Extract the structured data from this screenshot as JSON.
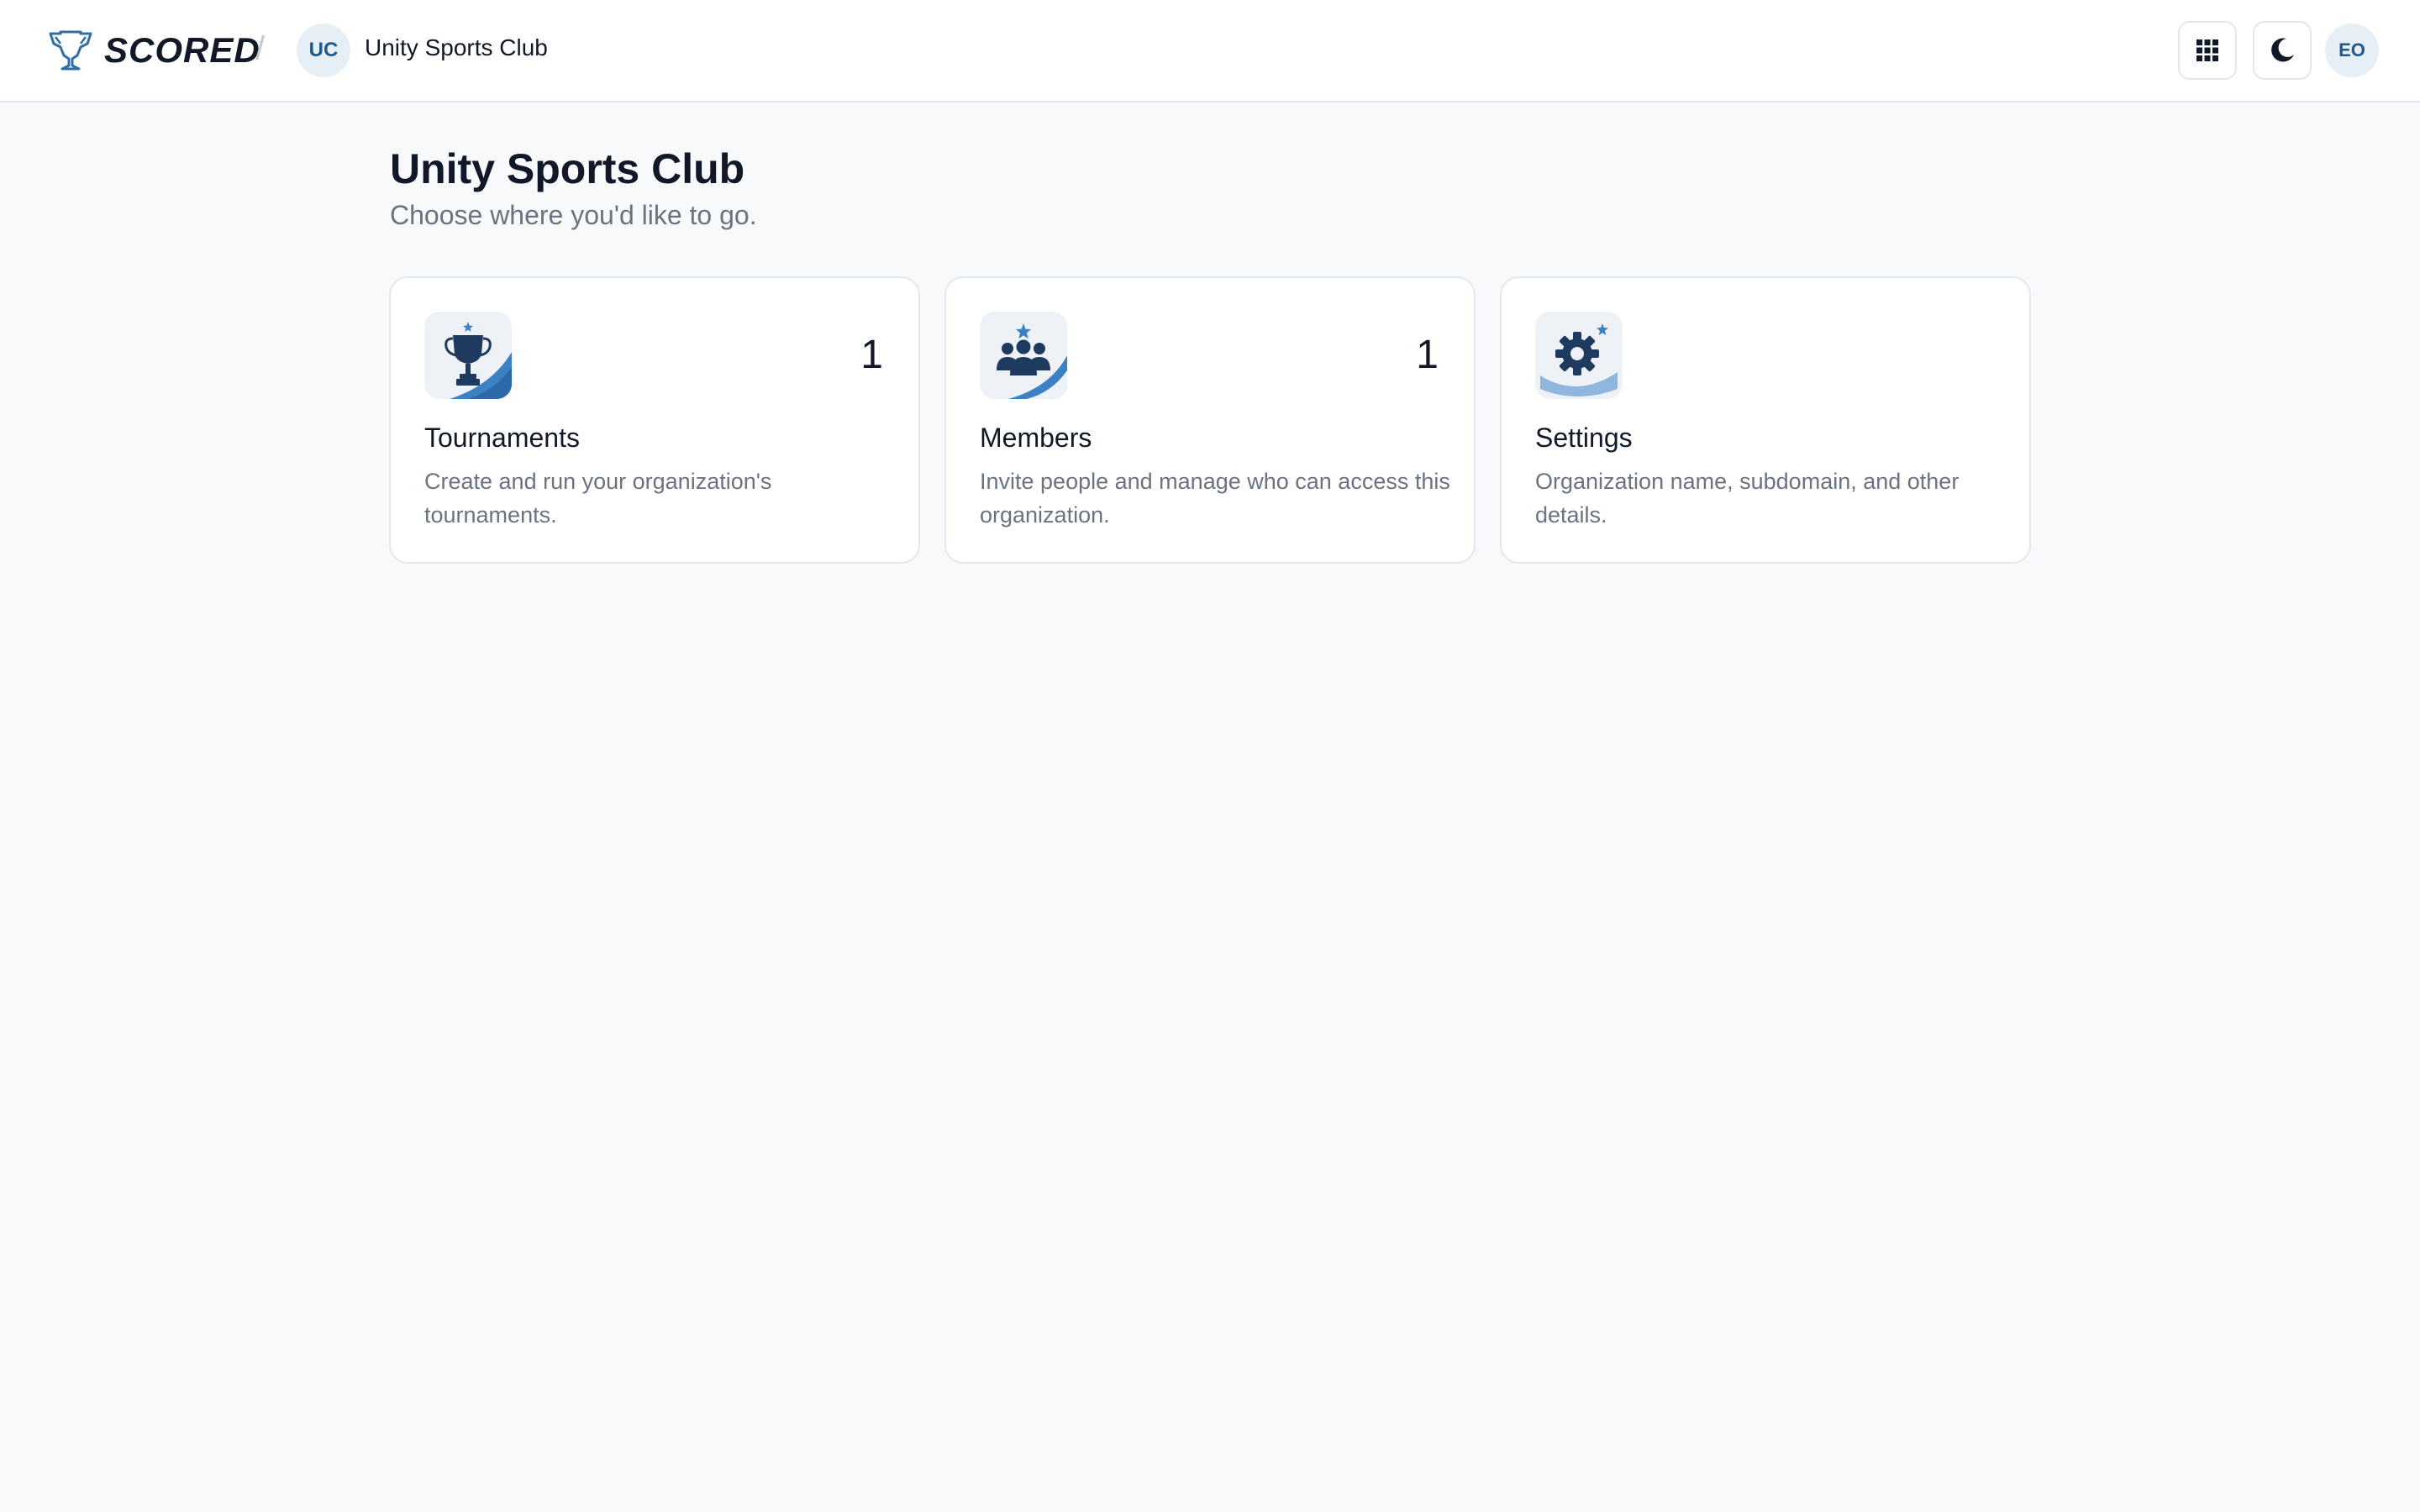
{
  "header": {
    "brand_name": "SCORED",
    "separator": "/",
    "org_initials": "UC",
    "org_name": "Unity Sports Club",
    "user_initials": "EO"
  },
  "page": {
    "title": "Unity Sports Club",
    "subtitle": "Choose where you'd like to go."
  },
  "cards": [
    {
      "title": "Tournaments",
      "count": "1",
      "description": "Create and run your organization's tournaments.",
      "icon": "trophy-icon"
    },
    {
      "title": "Members",
      "count": "1",
      "description": "Invite people and manage who can access this organization.",
      "icon": "members-icon"
    },
    {
      "title": "Settings",
      "count": "",
      "description": "Organization name, subdomain, and other details.",
      "icon": "gear-icon"
    }
  ],
  "colors": {
    "accent": "#3b82c4",
    "icon_dark": "#1e3a5f",
    "background": "#f8f9fb"
  }
}
